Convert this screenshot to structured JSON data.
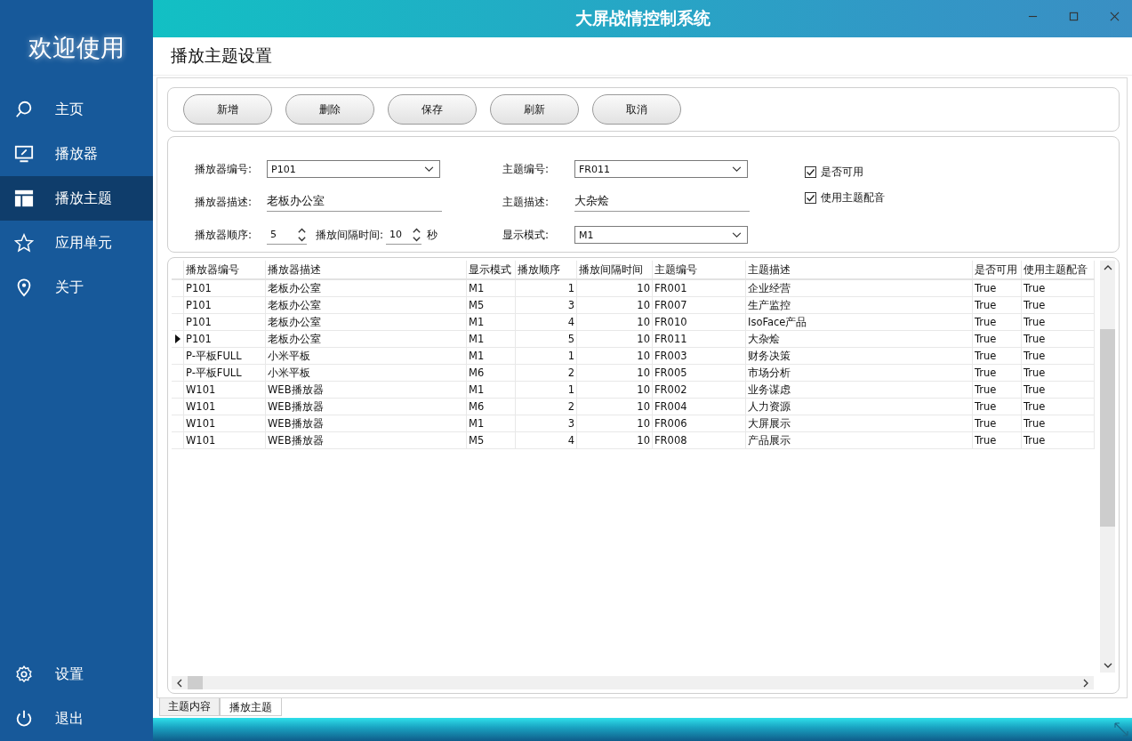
{
  "window": {
    "title": "大屏战情控制系统"
  },
  "sidebar": {
    "title": "欢迎使用",
    "items": [
      {
        "label": "主页",
        "selected": false
      },
      {
        "label": "播放器",
        "selected": false
      },
      {
        "label": "播放主题",
        "selected": true
      },
      {
        "label": "应用单元",
        "selected": false
      },
      {
        "label": "关于",
        "selected": false
      }
    ],
    "bottom_items": [
      {
        "label": "设置"
      },
      {
        "label": "退出"
      }
    ]
  },
  "page": {
    "title": "播放主题设置"
  },
  "toolbar": {
    "buttons": [
      "新增",
      "删除",
      "保存",
      "刷新",
      "取消"
    ]
  },
  "form": {
    "player_id": {
      "label": "播放器编号:",
      "value": "P101"
    },
    "player_desc": {
      "label": "播放器描述:",
      "value": "老板办公室"
    },
    "player_order": {
      "label": "播放器顺序:",
      "value": "5"
    },
    "interval": {
      "label": "播放间隔时间:",
      "value": "10",
      "unit": "秒"
    },
    "theme_id": {
      "label": "主题编号:",
      "value": "FR011"
    },
    "theme_desc": {
      "label": "主题描述:",
      "value": "大杂烩"
    },
    "display_mode": {
      "label": "显示模式:",
      "value": "M1"
    },
    "checkboxes": [
      {
        "label": "是否可用",
        "checked": true
      },
      {
        "label": "使用主题配音",
        "checked": true
      }
    ]
  },
  "table": {
    "columns": [
      {
        "label": "播放器编号",
        "kind": "text"
      },
      {
        "label": "播放器描述",
        "kind": "text"
      },
      {
        "label": "显示模式",
        "kind": "text"
      },
      {
        "label": "播放顺序",
        "kind": "number"
      },
      {
        "label": "播放间隔时间",
        "kind": "number"
      },
      {
        "label": "主题编号",
        "kind": "text"
      },
      {
        "label": "主题描述",
        "kind": "text"
      },
      {
        "label": "是否可用",
        "kind": "text"
      },
      {
        "label": "使用主题配音",
        "kind": "text"
      }
    ],
    "rows": [
      {
        "selected": false,
        "cells": [
          "P101",
          "老板办公室",
          "M1",
          "1",
          "10",
          "FR001",
          "企业经营",
          "True",
          "True"
        ]
      },
      {
        "selected": false,
        "cells": [
          "P101",
          "老板办公室",
          "M5",
          "3",
          "10",
          "FR007",
          "生产监控",
          "True",
          "True"
        ]
      },
      {
        "selected": false,
        "cells": [
          "P101",
          "老板办公室",
          "M1",
          "4",
          "10",
          "FR010",
          "IsoFace产品",
          "True",
          "True"
        ]
      },
      {
        "selected": true,
        "cells": [
          "P101",
          "老板办公室",
          "M1",
          "5",
          "10",
          "FR011",
          "大杂烩",
          "True",
          "True"
        ]
      },
      {
        "selected": false,
        "cells": [
          "P-平板FULL",
          "小米平板",
          "M1",
          "1",
          "10",
          "FR003",
          "财务决策",
          "True",
          "True"
        ]
      },
      {
        "selected": false,
        "cells": [
          "P-平板FULL",
          "小米平板",
          "M6",
          "2",
          "10",
          "FR005",
          "市场分析",
          "True",
          "True"
        ]
      },
      {
        "selected": false,
        "cells": [
          "W101",
          "WEB播放器",
          "M1",
          "1",
          "10",
          "FR002",
          "业务谋虑",
          "True",
          "True"
        ]
      },
      {
        "selected": false,
        "cells": [
          "W101",
          "WEB播放器",
          "M6",
          "2",
          "10",
          "FR004",
          "人力资源",
          "True",
          "True"
        ]
      },
      {
        "selected": false,
        "cells": [
          "W101",
          "WEB播放器",
          "M1",
          "3",
          "10",
          "FR006",
          "大屏展示",
          "True",
          "True"
        ]
      },
      {
        "selected": false,
        "cells": [
          "W101",
          "WEB播放器",
          "M5",
          "4",
          "10",
          "FR008",
          "产品展示",
          "True",
          "True"
        ]
      }
    ]
  },
  "bottom_tabs": [
    {
      "label": "主题内容",
      "selected": false
    },
    {
      "label": "播放主题",
      "selected": true
    }
  ]
}
